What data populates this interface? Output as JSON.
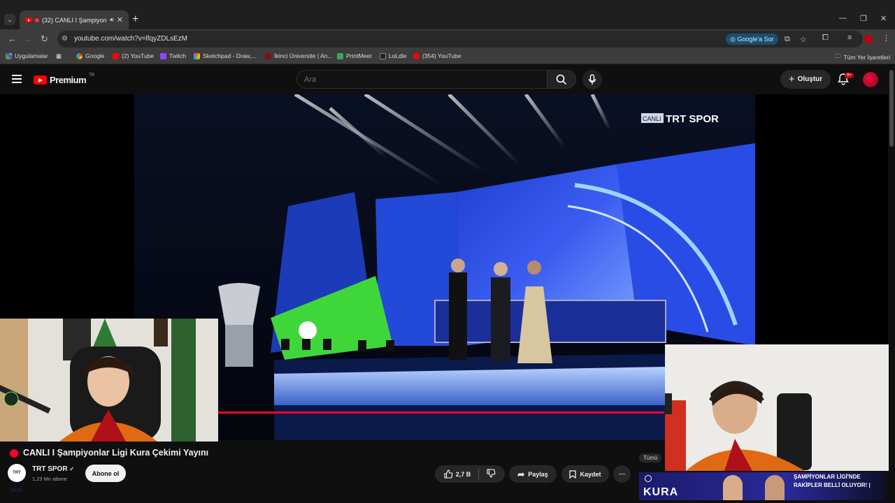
{
  "browser": {
    "tab_title": "(32) CANLI I Şampiyonla...",
    "tab_close": "✕",
    "new_tab": "+",
    "url": "youtube.com/watch?v=lfqyZDLsEzM",
    "google_ask": "Google'a Sor",
    "bookmarks": [
      {
        "label": "Uygulamalar"
      },
      {
        "label": "Google"
      },
      {
        "label": "(2) YouTube"
      },
      {
        "label": "Twitch"
      },
      {
        "label": "Sketchpad - Draw,..."
      },
      {
        "label": "İkinci Üniversite | An..."
      },
      {
        "label": "PrintMeet"
      },
      {
        "label": "LoLdle"
      },
      {
        "label": "(354) YouTube"
      }
    ],
    "all_bookmarks": "Tüm Yer İşaretleri"
  },
  "youtube": {
    "logo_word": "Premium",
    "logo_region": "TR",
    "search_placeholder": "Ara",
    "create_label": "Oluştur",
    "notification_badge": "9+"
  },
  "video": {
    "channel_bug_live": "CANLI",
    "channel_bug_name": "TRT SPOR",
    "title": "CANLI I Şampiyonlar Ligi Kura Çekimi Yayını",
    "channel_name": "TRT SPOR",
    "channel_avatar_text": "TRT SPOR",
    "subscribers": "1,23 Mn abone",
    "subscribe_label": "Abone ol",
    "likes": "2,7 B",
    "share_label": "Paylaş",
    "save_label": "Kaydet",
    "more_label": "⋯"
  },
  "sidebar": {
    "filter_tooltip": "Tümü",
    "rec_card_overlay": "KURA",
    "rec_title": "ŞAMPİYONLAR LİGİ'NDE RAKİPLER BELLİ OLUYOR! |"
  },
  "colors": {
    "accent_red": "#ff0033",
    "bg": "#0f0f0f",
    "chip": "#272727"
  }
}
